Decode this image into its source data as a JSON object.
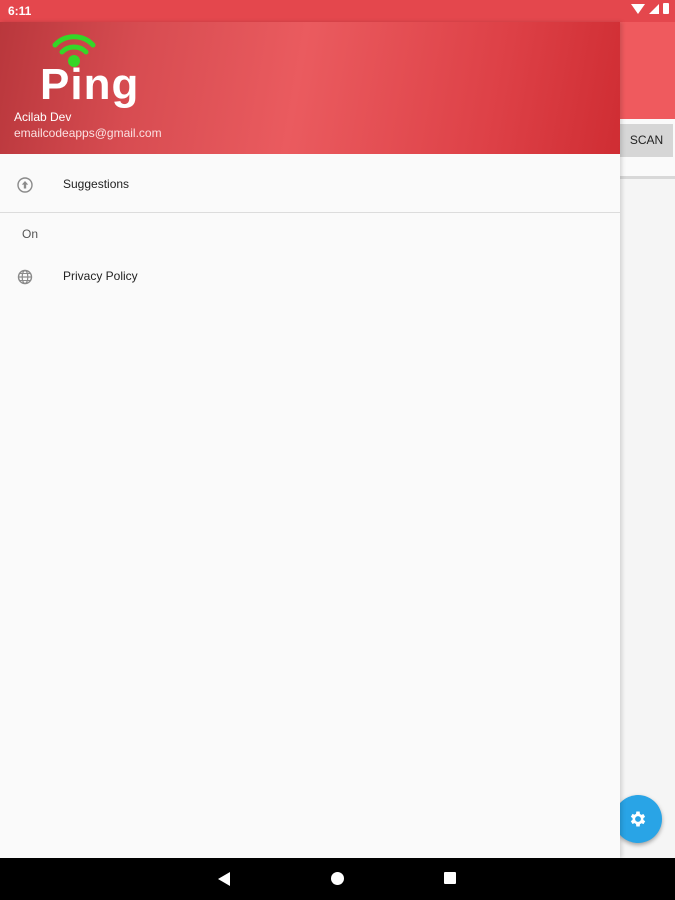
{
  "status_bar": {
    "time": "6:11",
    "icons": [
      "wifi-icon",
      "signal-icon",
      "battery-icon"
    ]
  },
  "app": {
    "scan_label": "SCAN",
    "fab_icon": "gear-icon",
    "colors": {
      "toolbar": "#ef5a5e",
      "fab": "#29a4e6"
    }
  },
  "drawer": {
    "header": {
      "logo_text": "Ping",
      "account_name": "Acilab Dev",
      "account_email": "emailcodeapps@gmail.com",
      "colors": {
        "primary": "#e4474d",
        "logo_wifi": "#35d627"
      }
    },
    "items": [
      {
        "label": "Suggestions",
        "icon": "upload-circle-icon"
      }
    ],
    "section": {
      "title": "On",
      "items": [
        {
          "label": "Privacy Policy",
          "icon": "globe-icon"
        }
      ]
    }
  },
  "nav_bar": {
    "buttons": [
      "back-icon",
      "home-icon",
      "recents-icon"
    ]
  }
}
